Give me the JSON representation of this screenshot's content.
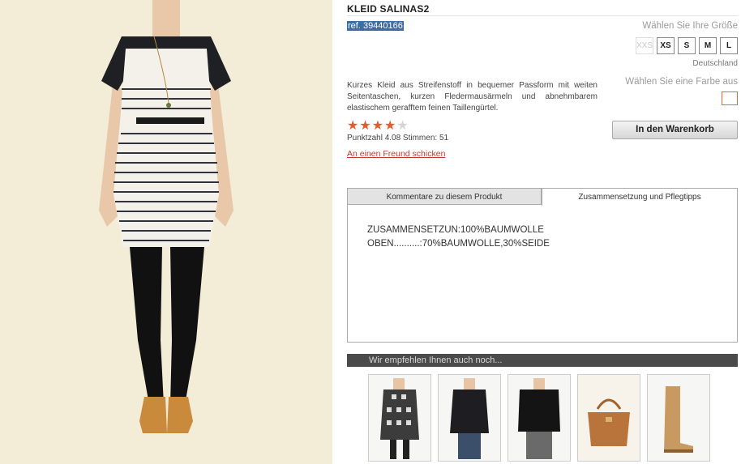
{
  "product": {
    "title": "KLEID SALINAS2",
    "ref": "ref. 39440166",
    "description": "Kurzes Kleid aus Streifenstoff in bequemer Passform mit weiten Seitentaschen, kurzen Fledermausärmeln und abnehmbarem elastischem gerafftem feinen Taillengürtel."
  },
  "size_selector": {
    "label": "Wählen Sie Ihre Größe",
    "sizes": [
      {
        "label": "XXS",
        "available": false
      },
      {
        "label": "XS",
        "available": true
      },
      {
        "label": "S",
        "available": true
      },
      {
        "label": "M",
        "available": true
      },
      {
        "label": "L",
        "available": true
      }
    ],
    "country": "Deutschland"
  },
  "color_selector": {
    "label": "Wählen Sie eine Farbe aus",
    "swatch_border": "#d07040"
  },
  "cart": {
    "label": "In den Warenkorb"
  },
  "rating": {
    "value": 4.08,
    "max": 5,
    "filled_stars": 4,
    "text": "Punktzahl 4.08 Stimmen: 51",
    "star_color": "#e05d2e"
  },
  "send_friend": "An einen Freund schicken",
  "tabs": {
    "items": [
      {
        "label": "Kommentare zu diesem Produkt",
        "active": false
      },
      {
        "label": "Zusammensetzung und Pflegtipps",
        "active": true
      }
    ],
    "content_line1": "ZUSAMMENSETZUN:100%BAUMWOLLE",
    "content_line2": "OBEN..........:70%BAUMWOLLE,30%SEIDE"
  },
  "recommendations": {
    "heading": "Wir empfehlen Ihnen auch noch...",
    "items": [
      {
        "icon": "plaid-dress-vest-thumbnail"
      },
      {
        "icon": "black-cardigan-thumbnail"
      },
      {
        "icon": "leather-jacket-thumbnail"
      },
      {
        "icon": "brown-handbag-thumbnail"
      },
      {
        "icon": "tan-boots-thumbnail"
      }
    ]
  },
  "colors": {
    "link": "#c0392b",
    "rec_bar": "#4a4a4a",
    "ref_highlight": "#3a6ea5"
  }
}
